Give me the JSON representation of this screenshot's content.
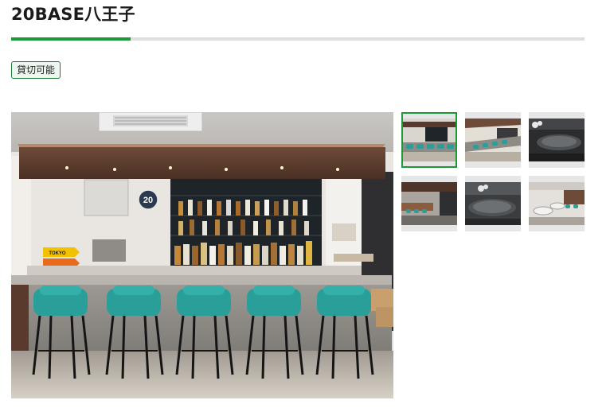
{
  "page": {
    "title": "20BASE八王子",
    "badge": "貸切可能",
    "accent_color": "#1a9a37"
  },
  "gallery": {
    "main_image": {
      "description_icon": "bar-counter-photo",
      "sign_text": "20",
      "arrow_sign_text": "TOKYO"
    },
    "thumbnails": [
      {
        "name": "thumb-bar-counter",
        "active": true
      },
      {
        "name": "thumb-bar-side-view",
        "active": false
      },
      {
        "name": "thumb-poker-table",
        "active": false
      },
      {
        "name": "thumb-bar-corridor",
        "active": false
      },
      {
        "name": "thumb-poker-room",
        "active": false
      },
      {
        "name": "thumb-lounge-tables",
        "active": false
      }
    ]
  }
}
